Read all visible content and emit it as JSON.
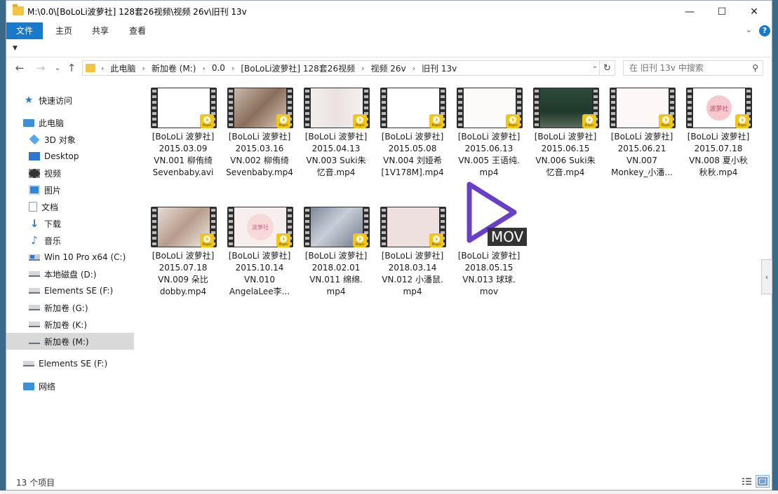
{
  "window": {
    "title": "M:\\0.0\\[BoLoLi波萝社] 128套26视频\\视频 26v\\旧刊 13v",
    "minimize_glyph": "—",
    "maximize_glyph": "☐",
    "close_glyph": "✕"
  },
  "ribbon": {
    "tabs": [
      {
        "label": "文件",
        "active": true
      },
      {
        "label": "主页",
        "active": false
      },
      {
        "label": "共享",
        "active": false
      },
      {
        "label": "查看",
        "active": false
      }
    ],
    "help_label": "?"
  },
  "address": {
    "breadcrumbs": [
      "此电脑",
      "新加卷 (M:)",
      "0.0",
      "[BoLoLi波萝社] 128套26视频",
      "视频 26v",
      "旧刊 13v"
    ]
  },
  "search": {
    "placeholder": "在 旧刊 13v 中搜索"
  },
  "nav": {
    "items": [
      {
        "label": "快速访问",
        "icon": "star-icon"
      },
      {
        "label": "此电脑",
        "icon": "computer-icon"
      },
      {
        "label": "3D 对象",
        "icon": "3d-objects-icon"
      },
      {
        "label": "Desktop",
        "icon": "desktop-icon"
      },
      {
        "label": "视频",
        "icon": "video-folder-icon"
      },
      {
        "label": "图片",
        "icon": "pictures-icon"
      },
      {
        "label": "文档",
        "icon": "documents-icon"
      },
      {
        "label": "下载",
        "icon": "download-icon"
      },
      {
        "label": "音乐",
        "icon": "music-icon"
      },
      {
        "label": "Win 10 Pro x64 (C:)",
        "icon": "windows-drive-icon"
      },
      {
        "label": "本地磁盘 (D:)",
        "icon": "drive-icon"
      },
      {
        "label": "Elements SE (F:)",
        "icon": "drive-icon"
      },
      {
        "label": "新加卷 (G:)",
        "icon": "drive-icon"
      },
      {
        "label": "新加卷 (K:)",
        "icon": "drive-icon"
      },
      {
        "label": "新加卷 (M:)",
        "icon": "drive-icon",
        "selected": true
      },
      {
        "label": "Elements SE (F:)",
        "icon": "drive-icon"
      },
      {
        "label": "网络",
        "icon": "network-icon"
      }
    ]
  },
  "files": [
    {
      "lines": [
        "[BoLoLi 波萝社]",
        "2015.03.09",
        "VN.001 柳侑绮",
        "Sevenbaby.avi"
      ]
    },
    {
      "lines": [
        "[BoLoLi 波萝社]",
        "2015.03.16",
        "VN.002 柳侑绮",
        "Sevenbaby.mp4"
      ]
    },
    {
      "lines": [
        "[BoLoLi 波萝社]",
        "2015.04.13",
        "VN.003 Suki朱",
        "忆音.mp4"
      ]
    },
    {
      "lines": [
        "[BoLoLi 波萝社]",
        "2015.05.08",
        "VN.004 刘娅希",
        "[1V178M].mp4"
      ]
    },
    {
      "lines": [
        "[BoLoLi 波萝社]",
        "2015.06.13",
        "VN.005 王语纯.",
        "mp4"
      ]
    },
    {
      "lines": [
        "[BoLoLi 波萝社]",
        "2015.06.15",
        "VN.006 Suki朱",
        "忆音.mp4"
      ]
    },
    {
      "lines": [
        "[BoLoLi 波萝社]",
        "2015.06.21",
        "VN.007",
        "Monkey_小潘..."
      ]
    },
    {
      "lines": [
        "[BoLoLi 波萝社]",
        "2015.07.18",
        "VN.008 夏小秋",
        "秋秋.mp4"
      ]
    },
    {
      "lines": [
        "[BoLoLi 波萝社]",
        "2015.07.18",
        "VN.009 朵比",
        "dobby.mp4"
      ]
    },
    {
      "lines": [
        "[BoLoLi 波萝社]",
        "2015.10.14",
        "VN.010",
        "AngelaLee李..."
      ]
    },
    {
      "lines": [
        "[BoLoLi 波萝社]",
        "2018.02.01",
        "VN.011 绵绵.",
        "mp4"
      ]
    },
    {
      "lines": [
        "[BoLoLi 波萝社]",
        "2018.03.14",
        "VN.012 小潘鼠.",
        "mp4"
      ]
    },
    {
      "lines": [
        "[BoLoLi 波萝社]",
        "2018.05.15",
        "VN.013 球球.",
        "mov"
      ]
    }
  ],
  "badge": {
    "label": "Player"
  },
  "thumb_texts": {
    "logo": "波萝社"
  },
  "mov_icon_label": "MOV",
  "status": {
    "count": "13 个项目"
  },
  "colors": {
    "accent": "#1979ca",
    "selection": "#d9d9d9",
    "badge": "#f3c614",
    "mov_purple": "#6a3fc8"
  }
}
